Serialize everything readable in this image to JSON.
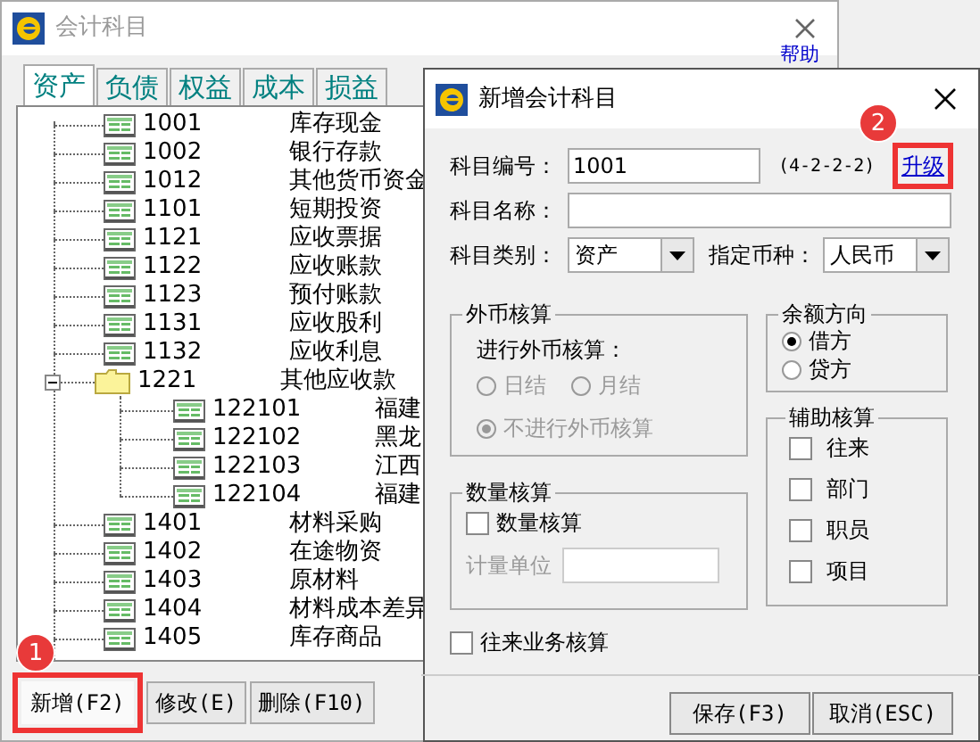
{
  "main_window": {
    "title": "会计科目",
    "help_link": "帮助",
    "tabs": [
      {
        "label": "资产",
        "selected": true
      },
      {
        "label": "负债",
        "selected": false
      },
      {
        "label": "权益",
        "selected": false
      },
      {
        "label": "成本",
        "selected": false
      },
      {
        "label": "损益",
        "selected": false
      }
    ],
    "tree": [
      {
        "kind": "account",
        "code": "1001",
        "name": "库存现金"
      },
      {
        "kind": "account",
        "code": "1002",
        "name": "银行存款"
      },
      {
        "kind": "account",
        "code": "1012",
        "name": "其他货币资金"
      },
      {
        "kind": "account",
        "code": "1101",
        "name": "短期投资"
      },
      {
        "kind": "account",
        "code": "1121",
        "name": "应收票据"
      },
      {
        "kind": "account",
        "code": "1122",
        "name": "应收账款"
      },
      {
        "kind": "account",
        "code": "1123",
        "name": "预付账款"
      },
      {
        "kind": "account",
        "code": "1131",
        "name": "应收股利"
      },
      {
        "kind": "account",
        "code": "1132",
        "name": "应收利息"
      },
      {
        "kind": "folder",
        "code": "1221",
        "name": "其他应收款",
        "expanded": true,
        "children": [
          {
            "kind": "account",
            "code": "122101",
            "name": "福建"
          },
          {
            "kind": "account",
            "code": "122102",
            "name": "黑龙"
          },
          {
            "kind": "account",
            "code": "122103",
            "name": "江西"
          },
          {
            "kind": "account",
            "code": "122104",
            "name": "福建"
          }
        ]
      },
      {
        "kind": "account",
        "code": "1401",
        "name": "材料采购"
      },
      {
        "kind": "account",
        "code": "1402",
        "name": "在途物资"
      },
      {
        "kind": "account",
        "code": "1403",
        "name": "原材料"
      },
      {
        "kind": "account",
        "code": "1404",
        "name": "材料成本差异"
      },
      {
        "kind": "account",
        "code": "1405",
        "name": "库存商品"
      }
    ],
    "buttons": [
      {
        "label": "新增(F2)",
        "highlighted": true
      },
      {
        "label": "修改(E)",
        "highlighted": false
      },
      {
        "label": "删除(F10)",
        "highlighted": false
      }
    ],
    "callout": "1"
  },
  "dialog": {
    "title": "新增会计科目",
    "code": {
      "label": "科目编号：",
      "value": "1001"
    },
    "format": "(4-2-2-2)",
    "upgrade_link": "升级",
    "callout": "2",
    "name": {
      "label": "科目名称："
    },
    "category": {
      "label": "科目类别：",
      "value": "资产"
    },
    "currency": {
      "label": "指定币种：",
      "value": "人民币"
    },
    "foreign": {
      "title": "外币核算",
      "prompt": "进行外币核算：",
      "disabled": true,
      "options": [
        {
          "label": "日结",
          "selected": false
        },
        {
          "label": "月结",
          "selected": false
        },
        {
          "label": "不进行外币核算",
          "selected": true
        }
      ]
    },
    "balance": {
      "title": "余额方向",
      "options": [
        {
          "label": "借方",
          "selected": true
        },
        {
          "label": "贷方",
          "selected": false
        }
      ]
    },
    "quantity": {
      "title": "数量核算",
      "check": {
        "label": "数量核算",
        "checked": false
      },
      "unit_label": "计量单位",
      "unit_disabled": true
    },
    "auxiliary": {
      "title": "辅助核算",
      "items": [
        {
          "label": "往来",
          "checked": false
        },
        {
          "label": "部门",
          "checked": false
        },
        {
          "label": "职员",
          "checked": false
        },
        {
          "label": "项目",
          "checked": false
        }
      ]
    },
    "business": {
      "label": "往来业务核算",
      "checked": false
    },
    "buttons": [
      "保存(F3)",
      "取消(ESC)"
    ]
  }
}
